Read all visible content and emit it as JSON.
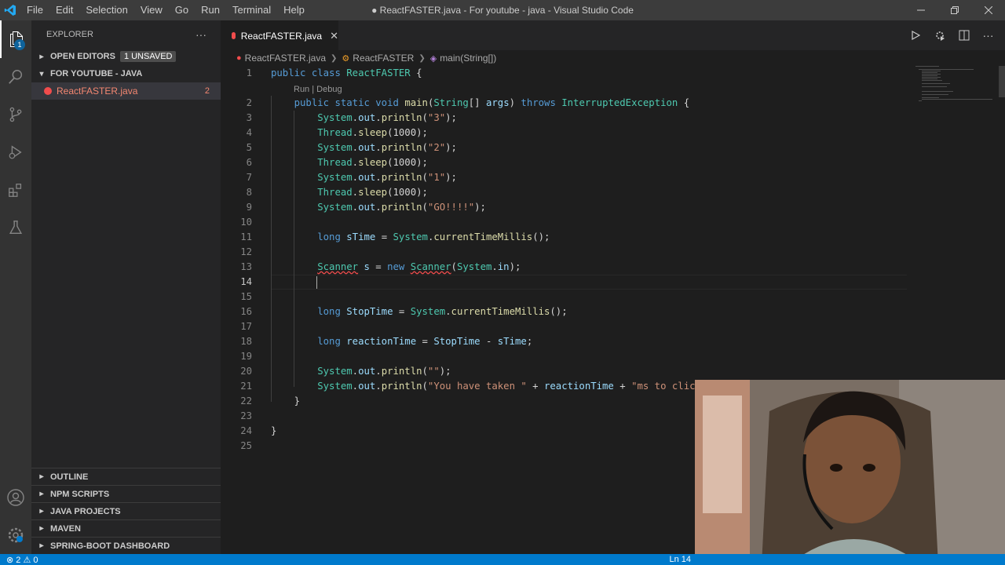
{
  "window": {
    "title": "● ReactFASTER.java - For youtube - java - Visual Studio Code",
    "menu": [
      "File",
      "Edit",
      "Selection",
      "View",
      "Go",
      "Run",
      "Terminal",
      "Help"
    ]
  },
  "activity_bar": {
    "icons": [
      "explorer-icon",
      "search-icon",
      "source-control-icon",
      "run-debug-icon",
      "extensions-icon",
      "testing-icon"
    ],
    "explorer_badge": "1",
    "bottom_icons": [
      "account-icon",
      "settings-icon"
    ]
  },
  "sidebar": {
    "title": "EXPLORER",
    "more": "···",
    "open_editors": {
      "label": "OPEN EDITORS",
      "badge": "1 UNSAVED"
    },
    "folder": {
      "label": "FOR YOUTUBE - JAVA"
    },
    "files": [
      {
        "name": "ReactFASTER.java",
        "problems": "2"
      }
    ],
    "bottom_sections": [
      "OUTLINE",
      "NPM SCRIPTS",
      "JAVA PROJECTS",
      "MAVEN",
      "SPRING-BOOT DASHBOARD"
    ]
  },
  "tab": {
    "label": "ReactFASTER.java",
    "close": "✕"
  },
  "breadcrumb": {
    "file": "ReactFASTER.java",
    "class": "ReactFASTER",
    "method": "main(String[])"
  },
  "codelens": "Run | Debug",
  "code_lines": [
    {
      "n": "1",
      "text": "public class ReactFASTER {"
    },
    {
      "n": "2",
      "text": "    public static void main(String[] args) throws InterruptedException {"
    },
    {
      "n": "3",
      "text": "        System.out.println(\"3\");"
    },
    {
      "n": "4",
      "text": "        Thread.sleep(1000);"
    },
    {
      "n": "5",
      "text": "        System.out.println(\"2\");"
    },
    {
      "n": "6",
      "text": "        Thread.sleep(1000);"
    },
    {
      "n": "7",
      "text": "        System.out.println(\"1\");"
    },
    {
      "n": "8",
      "text": "        Thread.sleep(1000);"
    },
    {
      "n": "9",
      "text": "        System.out.println(\"GO!!!!\");"
    },
    {
      "n": "10",
      "text": ""
    },
    {
      "n": "11",
      "text": "        long sTime = System.currentTimeMillis();"
    },
    {
      "n": "12",
      "text": ""
    },
    {
      "n": "13",
      "text": "        Scanner s = new Scanner(System.in);"
    },
    {
      "n": "14",
      "text": ""
    },
    {
      "n": "15",
      "text": ""
    },
    {
      "n": "16",
      "text": "        long StopTime = System.currentTimeMillis();"
    },
    {
      "n": "17",
      "text": ""
    },
    {
      "n": "18",
      "text": "        long reactionTime = StopTime - sTime;"
    },
    {
      "n": "19",
      "text": ""
    },
    {
      "n": "20",
      "text": "        System.out.println(\"\");"
    },
    {
      "n": "21",
      "text": "        System.out.println(\"You have taken \" + reactionTime + \"ms to click"
    },
    {
      "n": "22",
      "text": "    }"
    },
    {
      "n": "23",
      "text": ""
    },
    {
      "n": "24",
      "text": "}"
    },
    {
      "n": "25",
      "text": ""
    }
  ],
  "status_bar": {
    "problems": "⊗ 2 ⚠ 0",
    "cursor": "Ln 14"
  },
  "colors": {
    "accent": "#007acc",
    "error": "#f14c4c",
    "editor_bg": "#1e1e1e",
    "sidebar_bg": "#252526"
  }
}
